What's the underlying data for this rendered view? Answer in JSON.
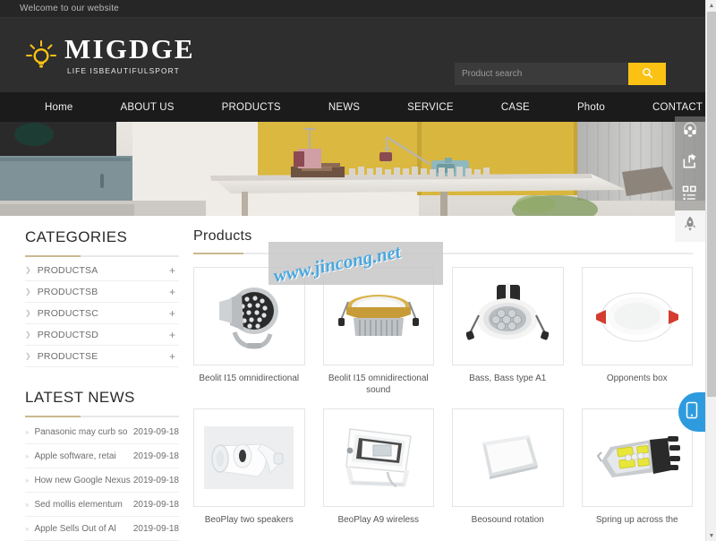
{
  "topbar": {
    "welcome": "Welcome to our website"
  },
  "brand": {
    "name": "MIGDGE",
    "tagline": "LIFE ISBEAUTIFULSPORT",
    "logo_icon": "lightbulb-icon",
    "accent_color": "#fbc214"
  },
  "search": {
    "placeholder": "Product search",
    "value": "",
    "button_icon": "search-icon"
  },
  "nav": {
    "items": [
      {
        "label": "Home"
      },
      {
        "label": "ABOUT US"
      },
      {
        "label": "PRODUCTS"
      },
      {
        "label": "NEWS"
      },
      {
        "label": "SERVICE"
      },
      {
        "label": "CASE"
      },
      {
        "label": "Photo"
      },
      {
        "label": "CONTACT"
      }
    ]
  },
  "sidebar": {
    "categories_title": "CATEGORIES",
    "categories": [
      {
        "label": "PRODUCTSA",
        "expander": "+"
      },
      {
        "label": "PRODUCTSB",
        "expander": "+"
      },
      {
        "label": "PRODUCTSC",
        "expander": "+"
      },
      {
        "label": "PRODUCTSD",
        "expander": "+"
      },
      {
        "label": "PRODUCTSE",
        "expander": "+"
      }
    ],
    "news_title": "LATEST NEWS",
    "news": [
      {
        "title": "Panasonic may curb so",
        "date": "2019-09-18"
      },
      {
        "title": "Apple software, retai",
        "date": "2019-09-18"
      },
      {
        "title": "How new Google Nexus",
        "date": "2019-09-18"
      },
      {
        "title": "Sed mollis elementum",
        "date": "2019-09-18"
      },
      {
        "title": "Apple Sells Out of Al",
        "date": "2019-09-18"
      }
    ]
  },
  "main": {
    "title": "Products",
    "products": [
      {
        "caption": "Beolit I15 omnidirectional",
        "image": "led-floodlight-round-array"
      },
      {
        "caption": "Beolit I15 omnidirectional sound",
        "image": "gold-downlight"
      },
      {
        "caption": "Bass, Bass type A1",
        "image": "white-spotlight-7led"
      },
      {
        "caption": "Opponents box",
        "image": "round-panel-light-red-clips"
      },
      {
        "caption": "BeoPlay two speakers",
        "image": "white-tube-fixture"
      },
      {
        "caption": "BeoPlay A9 wireless",
        "image": "white-led-floodlight"
      },
      {
        "caption": "Beosound rotation",
        "image": "flat-rect-panel-light"
      },
      {
        "caption": "Spring up across the",
        "image": "led-car-bulb"
      }
    ]
  },
  "watermark": {
    "text": "www.jincong.net",
    "color": "#4aa8e0"
  },
  "float_toolbar": {
    "buttons": [
      {
        "icon": "headset-service-icon"
      },
      {
        "icon": "share-icon"
      },
      {
        "icon": "qr-list-icon"
      },
      {
        "icon": "rocket-back-to-top-icon"
      }
    ]
  },
  "mobile_tab": {
    "icon": "mobile-phone-icon",
    "color": "#2e9bdf"
  },
  "scrollbar": {
    "up": "▲",
    "down": "▼"
  }
}
